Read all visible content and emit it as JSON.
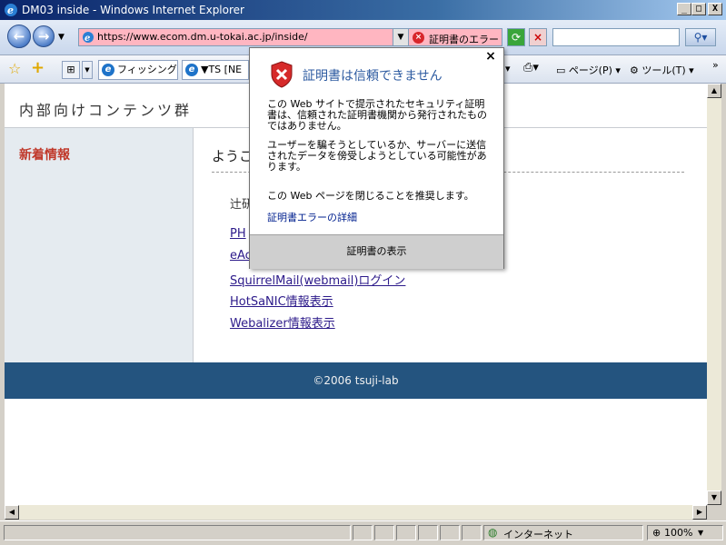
{
  "window": {
    "title": "DM03 inside - Windows Internet Explorer",
    "minimize": "_",
    "maximize": "□",
    "close": "X"
  },
  "nav": {
    "url": "https://www.ecom.dm.u-tokai.ac.jp/inside/",
    "cert_error": "証明書のエラー"
  },
  "tabs": [
    {
      "label": "フィッシング..."
    },
    {
      "label": "▼TS [NE"
    }
  ],
  "toolbar": {
    "page": "ページ(P)",
    "tools": "ツール(T)"
  },
  "page": {
    "header": "内部向けコンテンツ群",
    "sidebar_title": "新着情報",
    "welcome": "ようこ",
    "intro": "辻研",
    "links": [
      "PH",
      "eAc",
      "SquirrelMail(webmail)ログイン",
      "HotSaNIC情報表示",
      "Webalizer情報表示"
    ],
    "footer": "©2006 tsuji-lab"
  },
  "popup": {
    "title": "証明書は信頼できません",
    "close": "×",
    "para1": "この Web サイトで提示されたセキュリティ証明書は、信頼された証明書機関から発行されたものではありません。",
    "para2": "ユーザーを騙そうとしているか、サーバーに送信されたデータを傍受しようとしている可能性があります。",
    "para3": "この Web ページを閉じることを推奨します。",
    "details_link": "証明書エラーの詳細",
    "view_button": "証明書の表示"
  },
  "status": {
    "zone": "インターネット",
    "zoom": "100%"
  },
  "colors": {
    "error_bg": "#ffb6c1",
    "footer_bg": "#24547f",
    "sidebar_bg": "#e5ebf0",
    "news_red": "#c0392b"
  }
}
